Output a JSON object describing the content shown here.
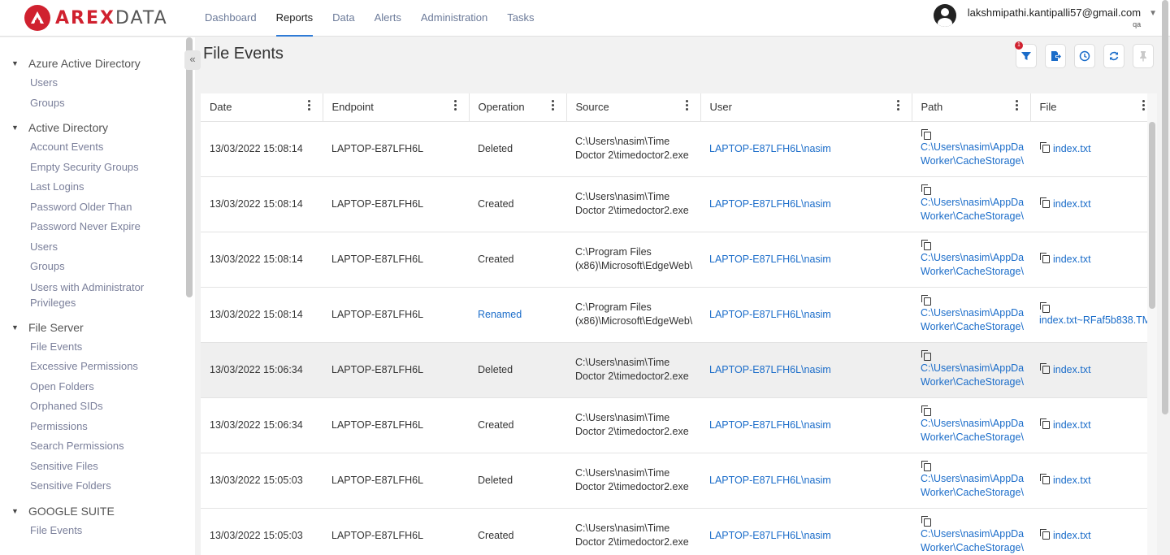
{
  "brand": {
    "logo_text_a": "AREX",
    "logo_text_b": "DATA"
  },
  "nav": [
    {
      "label": "Dashboard",
      "active": false
    },
    {
      "label": "Reports",
      "active": true
    },
    {
      "label": "Data",
      "active": false
    },
    {
      "label": "Alerts",
      "active": false
    },
    {
      "label": "Administration",
      "active": false
    },
    {
      "label": "Tasks",
      "active": false
    }
  ],
  "user": {
    "email": "lakshmipathi.kantipalli57@gmail.com",
    "role": "qa"
  },
  "sidebar": [
    {
      "title": "Azure Active Directory",
      "items": [
        "Users",
        "Groups"
      ]
    },
    {
      "title": "Active Directory",
      "items": [
        "Account Events",
        "Empty Security Groups",
        "Last Logins",
        "Password Older Than",
        "Password Never Expire",
        "Users",
        "Groups",
        "Users with Administrator Privileges"
      ]
    },
    {
      "title": "File Server",
      "items": [
        "File Events",
        "Excessive Permissions",
        "Open Folders",
        "Orphaned SIDs",
        "Permissions",
        "Search Permissions",
        "Sensitive Files",
        "Sensitive Folders"
      ]
    },
    {
      "title": "GOOGLE SUITE",
      "items": [
        "File Events"
      ]
    }
  ],
  "page": {
    "title": "File Events",
    "filter_count": "1"
  },
  "table": {
    "columns": [
      "Date",
      "Endpoint",
      "Operation",
      "Source",
      "User",
      "Path",
      "File"
    ],
    "rows": [
      {
        "date": "13/03/2022 15:08:14",
        "endpoint": "LAPTOP-E87LFH6L",
        "operation": "Deleted",
        "op_link": false,
        "source": "C:\\Users\\nasim\\Time Doctor 2\\timedoctor2.exe",
        "user": "LAPTOP-E87LFH6L\\nasim",
        "path1": "C:\\Users\\nasim\\AppDa",
        "path2": "Worker\\CacheStorage\\",
        "file": "index.txt",
        "highlight": false
      },
      {
        "date": "13/03/2022 15:08:14",
        "endpoint": "LAPTOP-E87LFH6L",
        "operation": "Created",
        "op_link": false,
        "source": "C:\\Users\\nasim\\Time Doctor 2\\timedoctor2.exe",
        "user": "LAPTOP-E87LFH6L\\nasim",
        "path1": "C:\\Users\\nasim\\AppDa",
        "path2": "Worker\\CacheStorage\\",
        "file": "index.txt",
        "highlight": false
      },
      {
        "date": "13/03/2022 15:08:14",
        "endpoint": "LAPTOP-E87LFH6L",
        "operation": "Created",
        "op_link": false,
        "source": "C:\\Program Files (x86)\\Microsoft\\EdgeWeb\\",
        "user": "LAPTOP-E87LFH6L\\nasim",
        "path1": "C:\\Users\\nasim\\AppDa",
        "path2": "Worker\\CacheStorage\\",
        "file": "index.txt",
        "highlight": false
      },
      {
        "date": "13/03/2022 15:08:14",
        "endpoint": "LAPTOP-E87LFH6L",
        "operation": "Renamed",
        "op_link": true,
        "source": "C:\\Program Files (x86)\\Microsoft\\EdgeWeb\\",
        "user": "LAPTOP-E87LFH6L\\nasim",
        "path1": "C:\\Users\\nasim\\AppDa",
        "path2": "Worker\\CacheStorage\\",
        "file": "index.txt~RFaf5b838.TM",
        "highlight": false
      },
      {
        "date": "13/03/2022 15:06:34",
        "endpoint": "LAPTOP-E87LFH6L",
        "operation": "Deleted",
        "op_link": false,
        "source": "C:\\Users\\nasim\\Time Doctor 2\\timedoctor2.exe",
        "user": "LAPTOP-E87LFH6L\\nasim",
        "path1": "C:\\Users\\nasim\\AppDa",
        "path2": "Worker\\CacheStorage\\",
        "file": "index.txt",
        "highlight": true
      },
      {
        "date": "13/03/2022 15:06:34",
        "endpoint": "LAPTOP-E87LFH6L",
        "operation": "Created",
        "op_link": false,
        "source": "C:\\Users\\nasim\\Time Doctor 2\\timedoctor2.exe",
        "user": "LAPTOP-E87LFH6L\\nasim",
        "path1": "C:\\Users\\nasim\\AppDa",
        "path2": "Worker\\CacheStorage\\",
        "file": "index.txt",
        "highlight": false
      },
      {
        "date": "13/03/2022 15:05:03",
        "endpoint": "LAPTOP-E87LFH6L",
        "operation": "Deleted",
        "op_link": false,
        "source": "C:\\Users\\nasim\\Time Doctor 2\\timedoctor2.exe",
        "user": "LAPTOP-E87LFH6L\\nasim",
        "path1": "C:\\Users\\nasim\\AppDa",
        "path2": "Worker\\CacheStorage\\",
        "file": "index.txt",
        "highlight": false
      },
      {
        "date": "13/03/2022 15:05:03",
        "endpoint": "LAPTOP-E87LFH6L",
        "operation": "Created",
        "op_link": false,
        "source": "C:\\Users\\nasim\\Time Doctor 2\\timedoctor2.exe",
        "user": "LAPTOP-E87LFH6L\\nasim",
        "path1": "C:\\Users\\nasim\\AppDa",
        "path2": "Worker\\CacheStorage\\",
        "file": "index.txt",
        "highlight": false
      }
    ]
  },
  "colors": {
    "brand": "#d0212f",
    "link": "#1a6cc9",
    "accent": "#2f7bd6"
  }
}
